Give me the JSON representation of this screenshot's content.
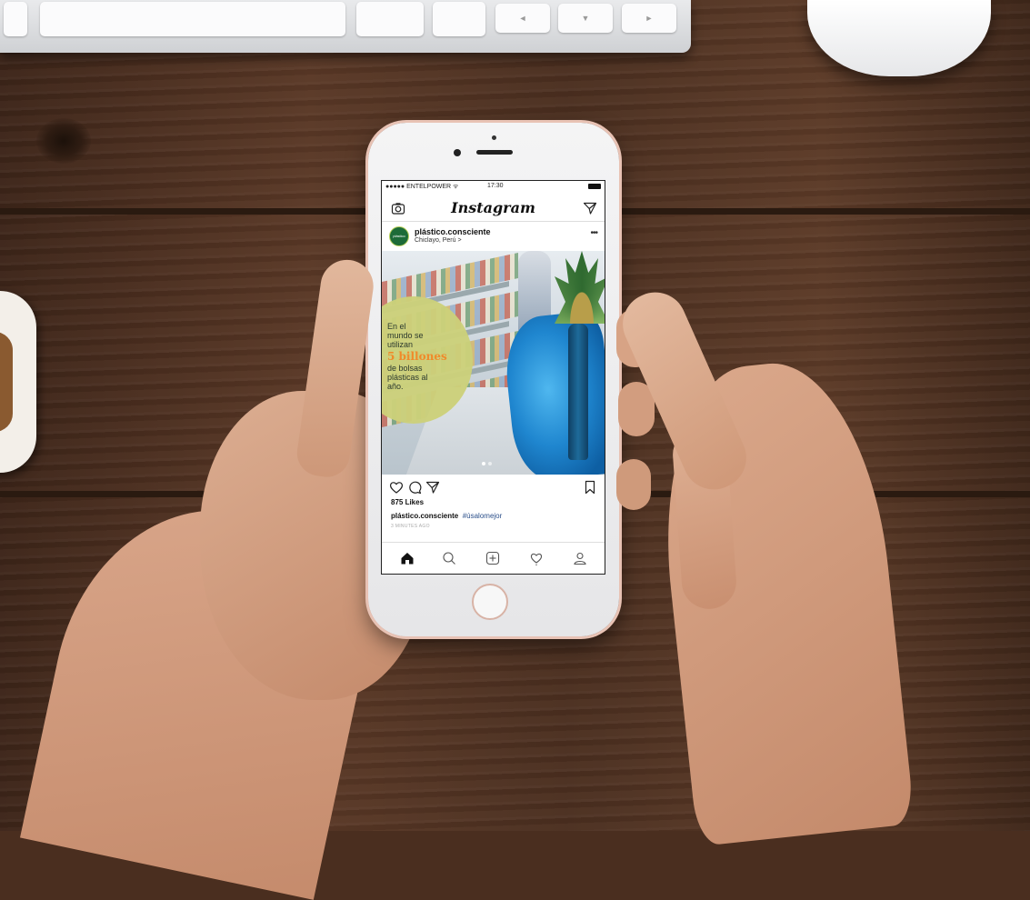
{
  "scene": {
    "keyboard_keys": [
      "◄",
      "▼",
      "►"
    ]
  },
  "status_bar": {
    "carrier": "●●●●● ENTELPOWER ᯤ",
    "time": "17:30"
  },
  "app": {
    "title": "Instagram"
  },
  "post": {
    "username": "plástico.consciente",
    "location": "Chiclayo, Perú >",
    "avatar_text": "plástico",
    "overlay_line1": "En el",
    "overlay_line2": "mundo se",
    "overlay_line3": "utilizan",
    "overlay_highlight": "5 billones",
    "overlay_line4": "de bolsas",
    "overlay_line5": "plásticas al",
    "overlay_line6": "año.",
    "likes": "875 Likes",
    "caption_user": "plástico.consciente",
    "caption_tag": "#úsalomejor",
    "time_ago": "3 MINUTES AGO",
    "carousel_count": 2,
    "carousel_active": 1
  },
  "colors": {
    "circle": "#ccd07a",
    "highlight": "#f08a2a",
    "hashtag": "#2b4f8a",
    "avatar": "#1d6b38"
  },
  "icons": {
    "header_left": "camera-icon",
    "header_right": "direct-message-icon",
    "actions": [
      "heart-icon",
      "comment-icon",
      "share-icon",
      "bookmark-icon"
    ],
    "tabs": [
      "home-icon",
      "search-icon",
      "add-post-icon",
      "activity-icon",
      "profile-icon"
    ]
  }
}
